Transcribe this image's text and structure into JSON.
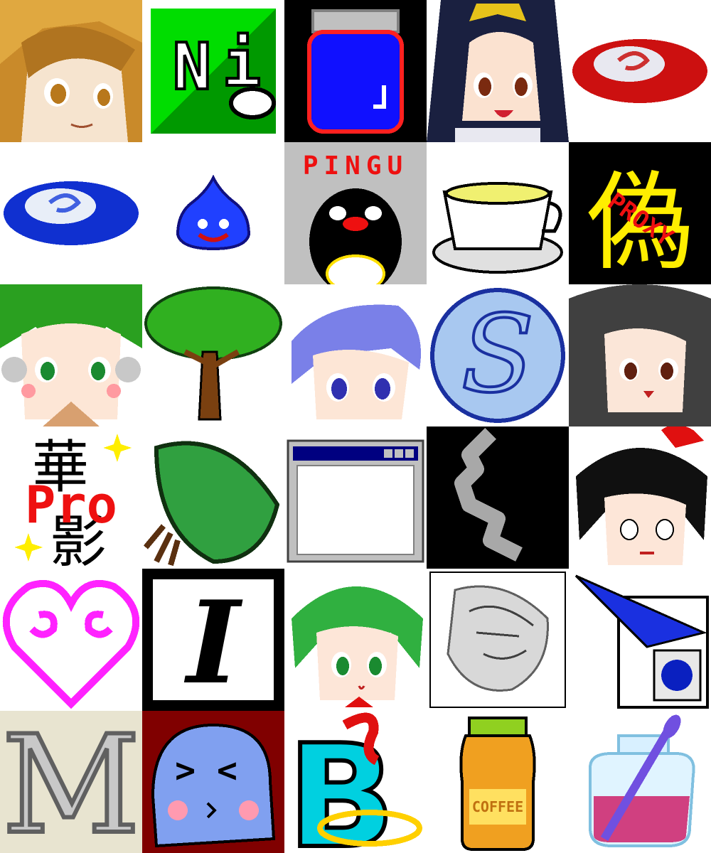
{
  "tiles": [
    {
      "name": "anime-girl-brown-hair-icon"
    },
    {
      "name": "ni-letters-icon",
      "text_n": "N",
      "text_i": "i"
    },
    {
      "name": "blue-ink-jar-icon"
    },
    {
      "name": "anime-girl-black-hair-bow-icon"
    },
    {
      "name": "red-plate-icon"
    },
    {
      "name": "blue-plate-icon"
    },
    {
      "name": "blue-slime-icon"
    },
    {
      "name": "pingu-penguin-icon",
      "text": "PINGU"
    },
    {
      "name": "tea-cup-icon"
    },
    {
      "name": "kanji-proxy-icon",
      "kanji": "偽",
      "word": "PROXY"
    },
    {
      "name": "anime-girl-green-hair-icon"
    },
    {
      "name": "green-tree-icon"
    },
    {
      "name": "anime-boy-blue-hair-icon"
    },
    {
      "name": "letter-s-circle-icon",
      "text": "S"
    },
    {
      "name": "anime-girl-gray-hair-icon"
    },
    {
      "name": "kanji-pro-logo-icon",
      "kanji_top": "華",
      "kanji_bottom": "影",
      "text": "Pro"
    },
    {
      "name": "green-leaf-icon"
    },
    {
      "name": "window-frame-icon"
    },
    {
      "name": "gray-smoke-icon"
    },
    {
      "name": "anime-girl-red-ribbon-icon"
    },
    {
      "name": "pink-heart-spiral-icon"
    },
    {
      "name": "italic-i-letter-icon",
      "text": "I"
    },
    {
      "name": "anime-girl-green-hair-red-ribbon-icon"
    },
    {
      "name": "sketch-portrait-icon"
    },
    {
      "name": "blue-folder-document-icon"
    },
    {
      "name": "silver-m-letter-icon",
      "text": "M"
    },
    {
      "name": "blue-ghost-face-icon",
      "eyes": "><"
    },
    {
      "name": "letter-b-snake-icon",
      "text": "B"
    },
    {
      "name": "coffee-bottle-icon",
      "label": "COFFEE"
    },
    {
      "name": "jam-jar-spoon-icon"
    }
  ],
  "colors": {
    "green": "#00cc00",
    "blue": "#0000ee",
    "red": "#ee0000",
    "yellow": "#ffee00",
    "magenta": "#ff22ff"
  }
}
